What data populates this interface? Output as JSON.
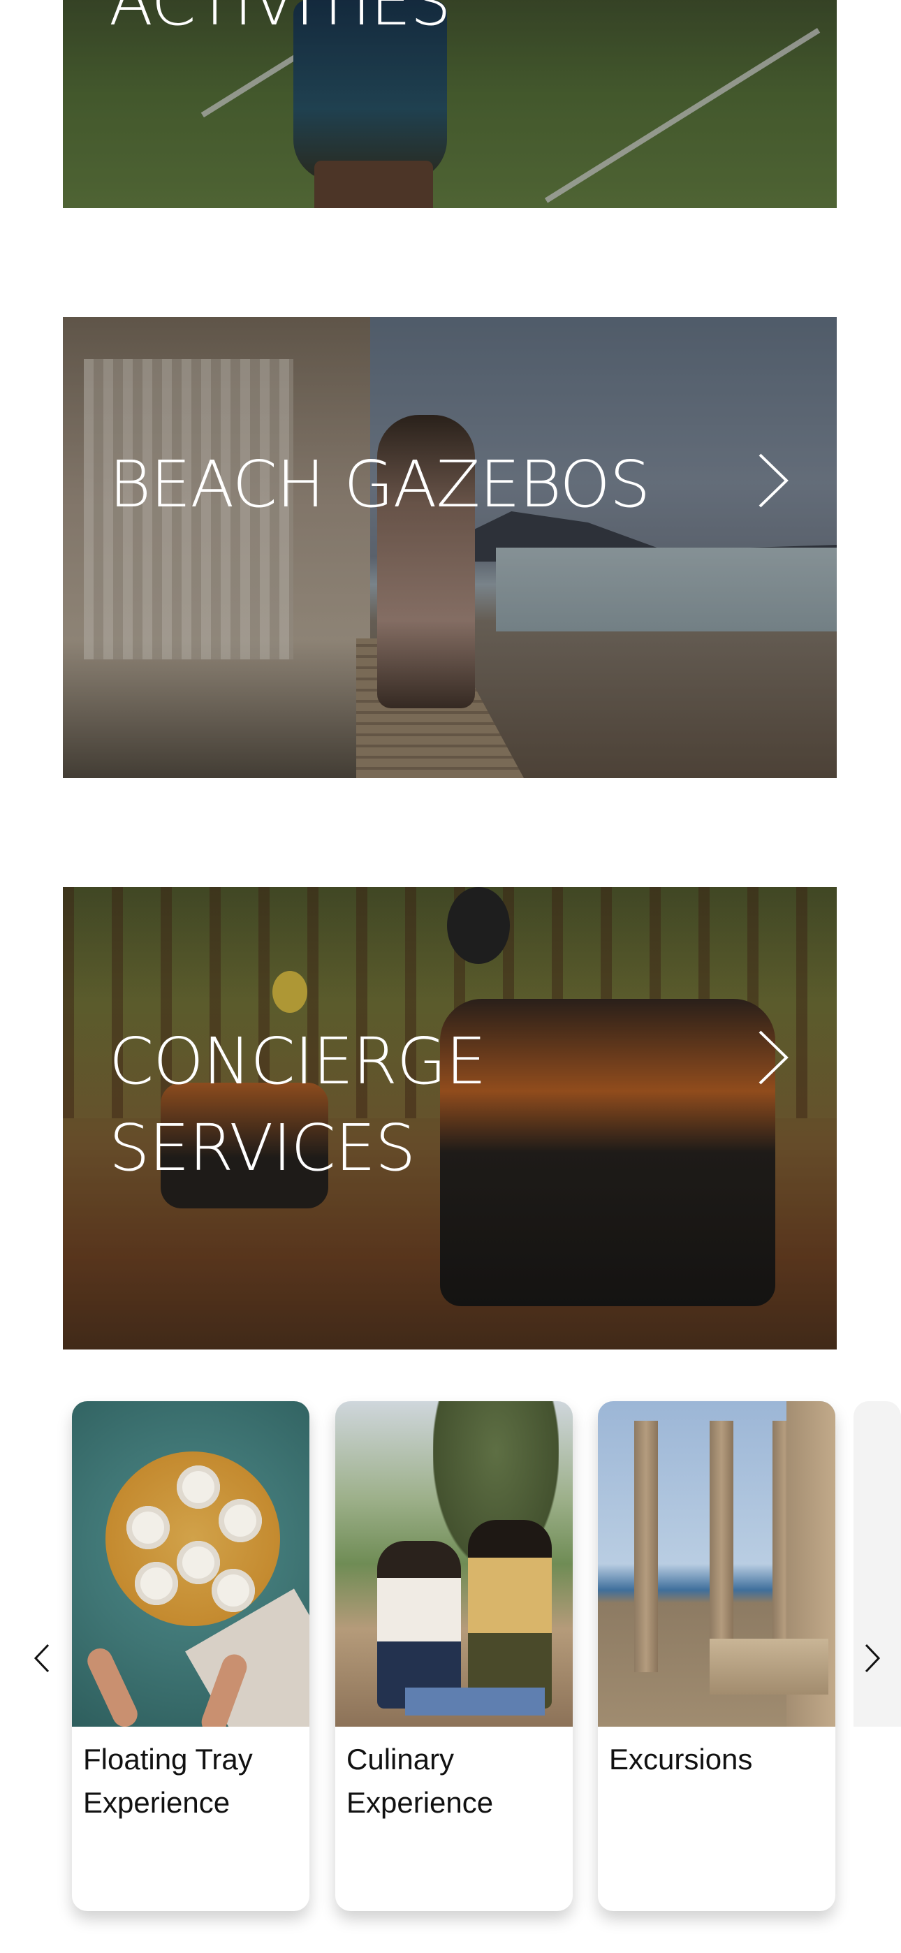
{
  "banners": [
    {
      "id": "activities",
      "title": "ACTIVITIES"
    },
    {
      "id": "beach-gazebos",
      "title": "BEACH GAZEBOS",
      "arrow_icon": "chevron-right-icon"
    },
    {
      "id": "concierge-services",
      "title": "CONCIERGE\nSERVICES",
      "arrow_icon": "chevron-right-icon"
    }
  ],
  "carousel": {
    "prev_icon": "chevron-left-icon",
    "next_icon": "chevron-right-icon",
    "cards": [
      {
        "title": "Floating Tray Experience"
      },
      {
        "title": "Culinary Experience"
      },
      {
        "title": "Excursions"
      }
    ]
  },
  "colors": {
    "text": "#111111",
    "banner_text": "#ffffff",
    "background": "#ffffff"
  }
}
